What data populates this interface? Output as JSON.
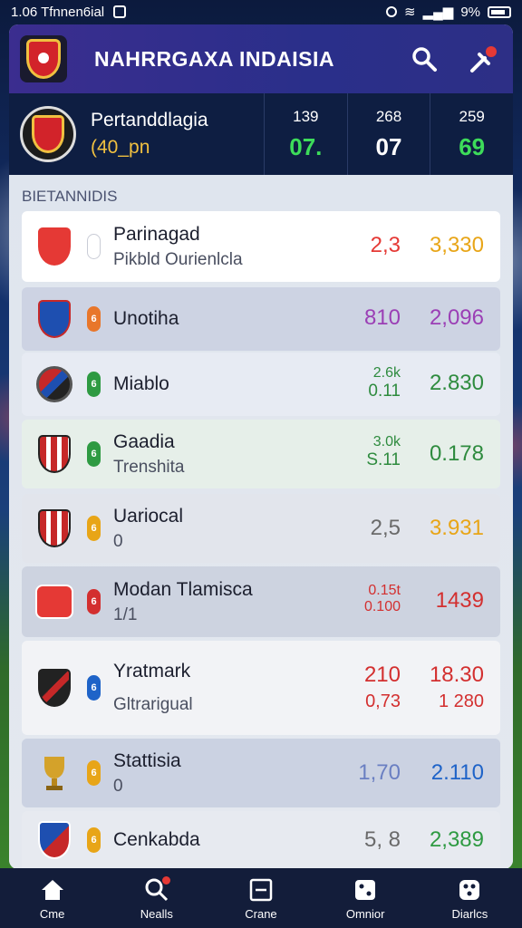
{
  "status_bar": {
    "time": "1.06 Tfnnen6ial",
    "battery": "9%"
  },
  "header": {
    "title": "NAHRRGAXA INDAISIA"
  },
  "summary": {
    "title": "Pertanddlagia",
    "subtitle": "(40_pn",
    "columns": [
      {
        "top": "139",
        "value": "07.",
        "color": "#3ddc5a"
      },
      {
        "top": "268",
        "value": "07",
        "color": "#ffffff"
      },
      {
        "top": "259",
        "value": "69",
        "color": "#3ddc5a"
      }
    ]
  },
  "list": {
    "section_label": "BIETANNIDIS",
    "rows": [
      {
        "name": "Parinagad",
        "sub": "Pikbld Ourienlcla",
        "val_a": "2,3",
        "val_a2": "",
        "val_b": "3,330",
        "color_a": "#e53935",
        "color_b": "#e8a517",
        "bg": "#ffffff",
        "pill": "",
        "pill_color": "#ffffff"
      },
      {
        "name": "Unotiha",
        "sub": "",
        "val_a": "810",
        "val_a2": "",
        "val_b": "2,096",
        "color_a": "#9b3fb5",
        "color_b": "#9b3fb5",
        "bg": "#cdd3e3",
        "pill": "6",
        "pill_color": "#e8762a"
      },
      {
        "name": "Miablo",
        "sub": "",
        "val_a": "2.6k",
        "val_a2": "0.11",
        "val_b": "2.830",
        "color_a": "#2e8b3e",
        "color_b": "#2e8b3e",
        "bg": "#e7ebf3",
        "pill": "6",
        "pill_color": "#2e9a42"
      },
      {
        "name": "Gaadia",
        "sub": "Trenshita",
        "val_a": "3.0k",
        "val_a2": "S.11",
        "val_b": "0.178",
        "color_a": "#2e8b3e",
        "color_b": "#2e8b3e",
        "bg": "#e6efe9",
        "pill": "6",
        "pill_color": "#2e9a42"
      },
      {
        "name": "Uariocal",
        "sub": "0",
        "val_a": "2,5",
        "val_a2": "",
        "val_b": "3.931",
        "color_a": "#6a6a6a",
        "color_b": "#e8a517",
        "bg": "#e2e5ec",
        "pill": "6",
        "pill_color": "#e8a517"
      },
      {
        "name": "Modan Tlamisca",
        "sub": "1/1",
        "val_a": "0.15t",
        "val_a2": "0.100",
        "val_b": "1439",
        "color_a": "#d32f2f",
        "color_b": "#d32f2f",
        "bg": "#cdd3e0",
        "pill": "6",
        "pill_color": "#d32f2f"
      },
      {
        "name": "Yratmark",
        "sub": "Gltrarigual",
        "val_a": "210",
        "val_a2": "0,73",
        "val_b": "18.30",
        "val_b2": "1 280",
        "color_a": "#d32f2f",
        "color_b": "#d32f2f",
        "bg": "#f2f3f6",
        "pill": "6",
        "pill_color": "#1e63c8"
      },
      {
        "name": "Stattisia",
        "sub": "0",
        "val_a": "1,70",
        "val_a2": "",
        "val_b": "2.110",
        "color_a": "#6a7fc2",
        "color_b": "#1e63c8",
        "bg": "#cbd2e2",
        "pill": "6",
        "pill_color": "#e8a517"
      },
      {
        "name": "Cenkabda",
        "sub": "",
        "val_a": "5, 8",
        "val_a2": "",
        "val_b": "2,389",
        "color_a": "#6a6a6a",
        "color_b": "#2e9a42",
        "bg": "#e7eaf0",
        "pill": "6",
        "pill_color": "#e8a517"
      }
    ]
  },
  "nav": {
    "items": [
      {
        "label": "Cme",
        "icon": "home-icon"
      },
      {
        "label": "Nealls",
        "icon": "search-icon"
      },
      {
        "label": "Crane",
        "icon": "scoreboard-icon"
      },
      {
        "label": "Omnior",
        "icon": "dice-icon"
      },
      {
        "label": "Diarlcs",
        "icon": "stats-icon"
      }
    ]
  }
}
